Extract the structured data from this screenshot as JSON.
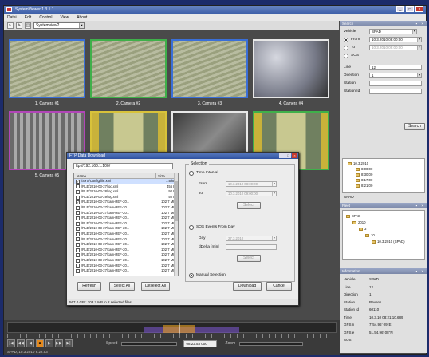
{
  "app": {
    "title": "SystemViewer 1.3.1.1"
  },
  "window_controls": {
    "minimize": "_",
    "maximize": "□",
    "close": "×"
  },
  "menu": [
    "Datei",
    "Edit",
    "Control",
    "View",
    "About"
  ],
  "toolbar": {
    "combo_value": "Systemview2",
    "tools": [
      "↖",
      "✎",
      "◫"
    ]
  },
  "cameras": [
    {
      "label": "1. Camera #1",
      "border": "#3a6fd8",
      "scene": "ceiling"
    },
    {
      "label": "2. Camera #2",
      "border": "#3fb04a",
      "scene": "ceiling"
    },
    {
      "label": "3. Camera #3",
      "border": "#3a6fd8",
      "scene": "ceiling"
    },
    {
      "label": "4. Camera #4",
      "border": "#e8e8e8",
      "scene": "wall"
    },
    {
      "label": "5. Camera #5",
      "border": "#b245b8",
      "scene": "tunnel"
    },
    {
      "label": "",
      "border": "#d8c23a",
      "scene": "train"
    },
    {
      "label": "",
      "border": "#e8e8e8",
      "scene": "dark"
    },
    {
      "label": "",
      "border": "#3fb04a",
      "scene": "train"
    }
  ],
  "dialog": {
    "title": "FTP Data Download",
    "path": "ftp://192.168.1.100/",
    "columns": {
      "name": "Name",
      "size": "Size"
    },
    "files": [
      {
        "name": "/SYS/Config/file.xml",
        "size": "1.6 kB",
        "checked": true,
        "selected": true
      },
      {
        "name": "/RLE/2010-03-27/log.xml",
        "size": "456 B",
        "checked": false
      },
      {
        "name": "/RLE/2010-03-28/log.xml",
        "size": "92 B",
        "checked": false
      },
      {
        "name": "/RLE/2010-03-29/log.xml",
        "size": "50 B",
        "checked": false
      },
      {
        "name": "/RLE/2010-03-27/cam-REF-20...",
        "size": "102.7 MB",
        "checked": true
      },
      {
        "name": "/RLE/2010-03-27/cam-REF-20...",
        "size": "102.7 MB",
        "checked": false
      },
      {
        "name": "/RLE/2010-03-27/cam-REF-20...",
        "size": "102.7 MB",
        "checked": false
      },
      {
        "name": "/RLE/2010-03-27/cam-REF-20...",
        "size": "102.7 MB",
        "checked": false
      },
      {
        "name": "/RLE/2010-03-27/cam-REF-20...",
        "size": "102.7 MB",
        "checked": false
      },
      {
        "name": "/RLE/2010-03-27/cam-REF-20...",
        "size": "102.7 MB",
        "checked": false
      },
      {
        "name": "/RLE/2010-03-27/cam-REF-20...",
        "size": "102.7 MB",
        "checked": false
      },
      {
        "name": "/RLE/2010-03-27/cam-REF-20...",
        "size": "102.7 MB",
        "checked": false
      },
      {
        "name": "/RLE/2010-03-27/cam-REF-20...",
        "size": "102.7 MB",
        "checked": false
      },
      {
        "name": "/RLE/2010-03-27/cam-REF-20...",
        "size": "102.7 MB",
        "checked": false
      },
      {
        "name": "/RLE/2010-03-27/cam-REF-20...",
        "size": "102.7 MB",
        "checked": false
      },
      {
        "name": "/RLE/2010-03-27/cam-REF-20...",
        "size": "102.7 MB",
        "checked": false
      },
      {
        "name": "/RLE/2010-03-27/cam-REF-20...",
        "size": "102.7 MB",
        "checked": false
      },
      {
        "name": "/RLE/2010-03-27/cam-REF-20...",
        "size": "102.7 MB",
        "checked": false
      }
    ],
    "buttons": {
      "refresh": "Refresh",
      "select_all": "Select All",
      "deselect_all": "Deselect All",
      "download": "Download",
      "cancel": "Cancel"
    },
    "selection": {
      "legend": "Selection",
      "time_interval": "Time Interval",
      "from_label": "From",
      "to_label": "To",
      "from_value": "10.3.2010 08:00:00",
      "to_value": "10.3.2010 09:00:00",
      "sos_label": "SOS Events From Day",
      "day_label": "Day",
      "day_value": "27.3.2010",
      "delta_label": "dDelta [min]",
      "select_btn": "Select",
      "manual_label": "Manual Selection"
    },
    "status": "567.0 GB : 103.7 MB in 2 selected files"
  },
  "right_panel": {
    "search_head": "Search",
    "vehicle_label": "Vehicle",
    "vehicle_value": "SPAD",
    "from_label": "From",
    "from_value": "10.3.2010 08:00:00",
    "to_label": "To",
    "to_value": "10.3.2010 09:00:00",
    "sos_label": "SOS",
    "line_label": "Line",
    "line_value": "12",
    "direction_label": "Direction",
    "direction_value": "1",
    "station_label": "Station",
    "station_id_label": "Station Id",
    "search_button": "Search",
    "result_tree": [
      "10.3.2010",
      "8:00:00",
      "8:30:00",
      "8:17:00",
      "8:21:00"
    ],
    "tree_footer": "SPAD",
    "fleet_head": "Fleet",
    "fleet_tree": [
      "SPAD",
      "2010",
      "3",
      "10",
      "10.3.2010 (SPAD)"
    ],
    "info_head": "Information",
    "info": [
      {
        "k": "Vehicle",
        "v": "SPAD"
      },
      {
        "k": "Line",
        "v": "12"
      },
      {
        "k": "Direction",
        "v": "1"
      },
      {
        "k": "Station",
        "v": "Ravens"
      },
      {
        "k": "Station Id",
        "v": "60110"
      },
      {
        "k": "Time",
        "v": "10.3.10 08:21:10.689"
      },
      {
        "k": "GPS n",
        "v": "7°54.96' 09°E"
      },
      {
        "k": "GPS e",
        "v": "51.54.96' 08°N"
      },
      {
        "k": "SOS",
        "v": ""
      }
    ]
  },
  "timeline": {
    "controls": [
      "|◀",
      "◀◀",
      "◀",
      "■",
      "▶",
      "▶▶",
      "▶|"
    ],
    "speed_label": "Speed",
    "time_value": "08:22:53 000",
    "zoom_label": "Zoom",
    "status": "SPAD, 10.3.2010 8:22:53"
  }
}
